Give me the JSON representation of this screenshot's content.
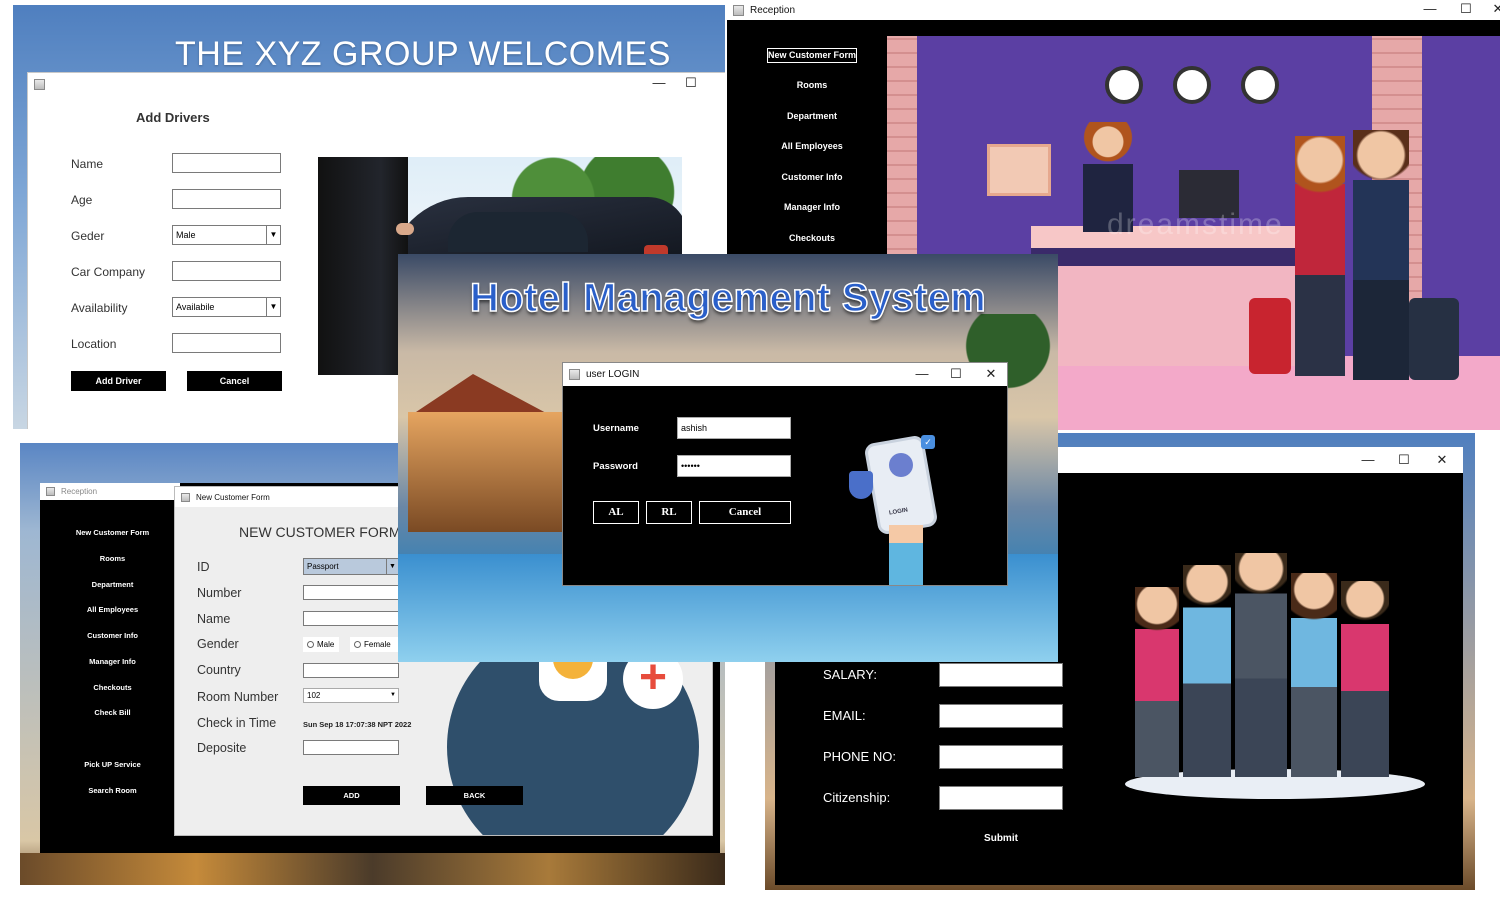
{
  "drivers_panel": {
    "banner": "THE XYZ GROUP WELCOMES YOU",
    "window": {
      "heading": "Add Drivers",
      "labels": [
        "Name",
        "Age",
        "Geder",
        "Car Company",
        "Availability",
        "Location"
      ],
      "gender_value": "Male",
      "availability_value": "Availabile",
      "add_button": "Add Driver",
      "cancel_button": "Cancel"
    }
  },
  "reception_panel": {
    "title": "Reception",
    "menu": [
      "New Customer Form",
      "Rooms",
      "Department",
      "All Employees",
      "Customer Info",
      "Manager Info",
      "Checkouts"
    ],
    "watermark": "dreamstime"
  },
  "login_panel": {
    "app_title": "Hotel Management System",
    "dialog_title": "user LOGIN",
    "username_label": "Username",
    "username_value": "ashish",
    "password_label": "Password",
    "password_value": "••••••",
    "buttons": [
      "AL",
      "RL",
      "Cancel"
    ],
    "phone_text": "LOGIN"
  },
  "customer_panel": {
    "reception_title": "Reception",
    "menu": [
      "New Customer Form",
      "Rooms",
      "Department",
      "All Employees",
      "Customer Info",
      "Manager Info",
      "Checkouts",
      "Check Bill",
      "Pick UP Service",
      "Search Room"
    ],
    "form_title": "New Customer Form",
    "heading": "NEW CUSTOMER FORM",
    "labels": [
      "ID",
      "Number",
      "Name",
      "Gender",
      "Country",
      "Room Number",
      "Check in Time",
      "Deposite"
    ],
    "id_value": "Passport",
    "gender_options": [
      "Male",
      "Female"
    ],
    "room_value": "102",
    "checkin_value": "Sun Sep 18 17:07:38 NPT 2022",
    "add_button": "ADD",
    "back_button": "BACK"
  },
  "employee_panel": {
    "labels": [
      "SALARY:",
      "EMAIL:",
      "PHONE NO:",
      "Citizenship:"
    ],
    "submit": "Submit"
  },
  "icons": {
    "minimize": "—",
    "maximize": "☐",
    "close": "✕",
    "dropdown": "▼"
  },
  "colors": {
    "sidebar": "#000000",
    "reception_bg": "#5b3fa3",
    "title_blue": "#2a5fc9"
  }
}
